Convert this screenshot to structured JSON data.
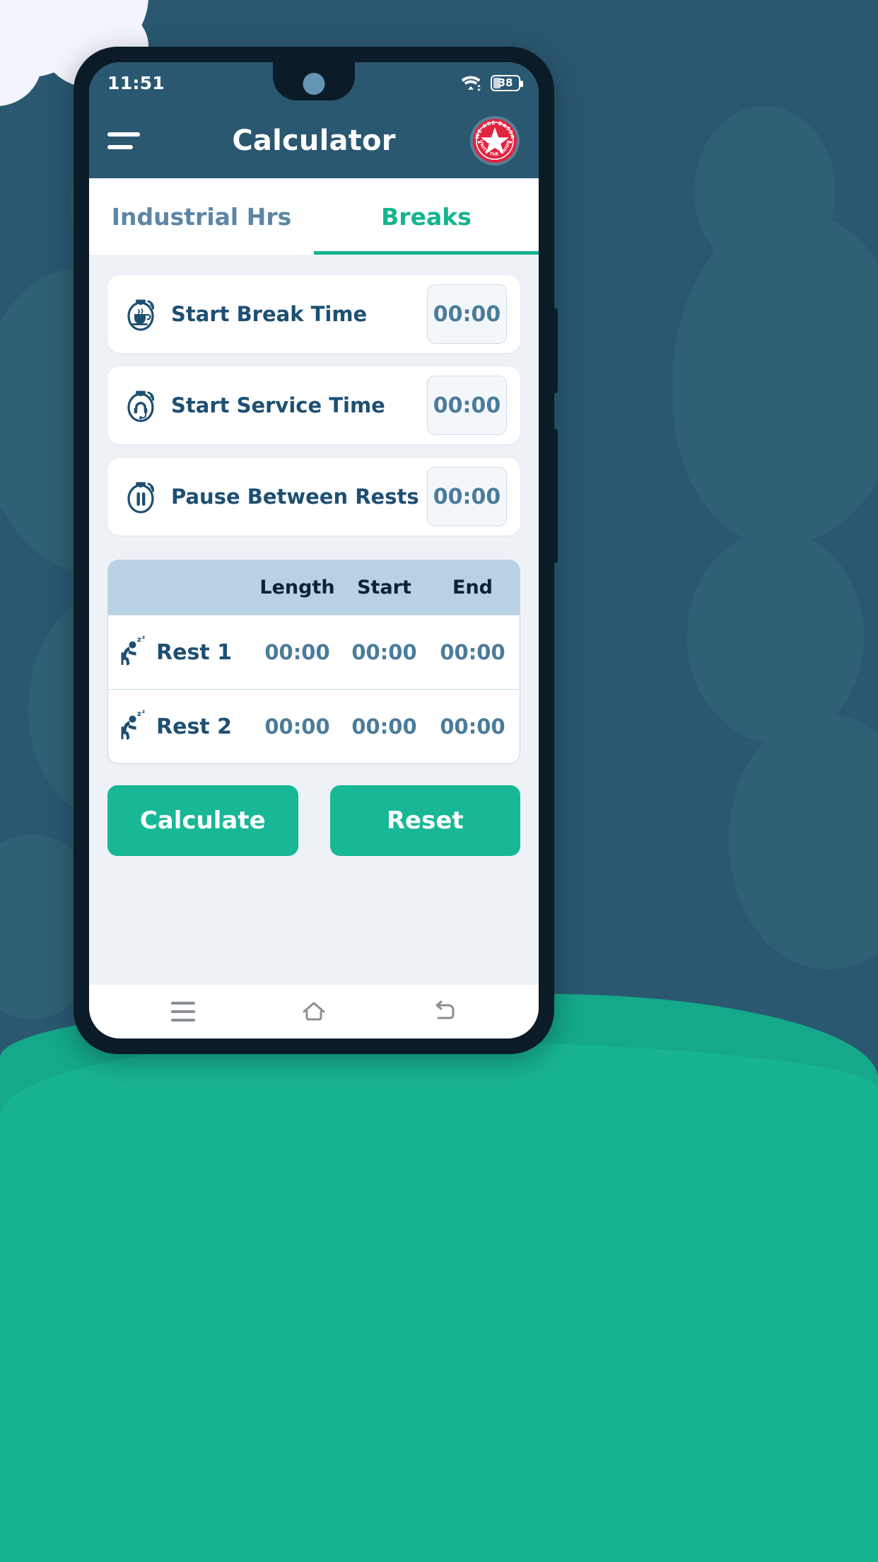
{
  "statusbar": {
    "time": "11:51",
    "wifi_icon": "wifi-icon",
    "battery_icon": "battery-icon",
    "battery_level": "38"
  },
  "appbar": {
    "menu_icon": "hamburger-menu-icon",
    "title": "Calculator",
    "logo_icon": "bassa-union-logo-icon",
    "logo_top_text": "WE ARE BASSA",
    "logo_bottom_text": "UNITE THE UNION"
  },
  "tabs": [
    {
      "label": "Industrial Hrs",
      "active": false
    },
    {
      "label": "Breaks",
      "active": true
    }
  ],
  "inputs": [
    {
      "icon": "stopwatch-coffee-icon",
      "label": "Start Break Time",
      "value": "00:00"
    },
    {
      "icon": "stopwatch-headset-icon",
      "label": "Start Service Time",
      "value": "00:00"
    },
    {
      "icon": "stopwatch-pause-icon",
      "label": "Pause Between Rests",
      "value": "00:00"
    }
  ],
  "rest_table": {
    "headers": [
      "",
      "Length",
      "Start",
      "End"
    ],
    "rows": [
      {
        "icon": "sleeping-person-icon",
        "name": "Rest 1",
        "length": "00:00",
        "start": "00:00",
        "end": "00:00"
      },
      {
        "icon": "sleeping-person-icon",
        "name": "Rest 2",
        "length": "00:00",
        "start": "00:00",
        "end": "00:00"
      }
    ]
  },
  "actions": {
    "calculate_label": "Calculate",
    "reset_label": "Reset"
  },
  "navbar": {
    "recent_icon": "recent-apps-icon",
    "home_icon": "home-icon",
    "back_icon": "back-arrow-icon"
  },
  "colors": {
    "wallpaper": "#2a5871",
    "appbar": "#2a5871",
    "accent_green": "#18b796",
    "tab_inactive": "#5d86a5",
    "label_blue": "#1d4f72",
    "value_blue": "#4a7c9b",
    "table_header": "#b8d2e3",
    "screen_bg": "#eef2f7",
    "logo_red": "#e2233f",
    "hill_green": "#17b493"
  }
}
